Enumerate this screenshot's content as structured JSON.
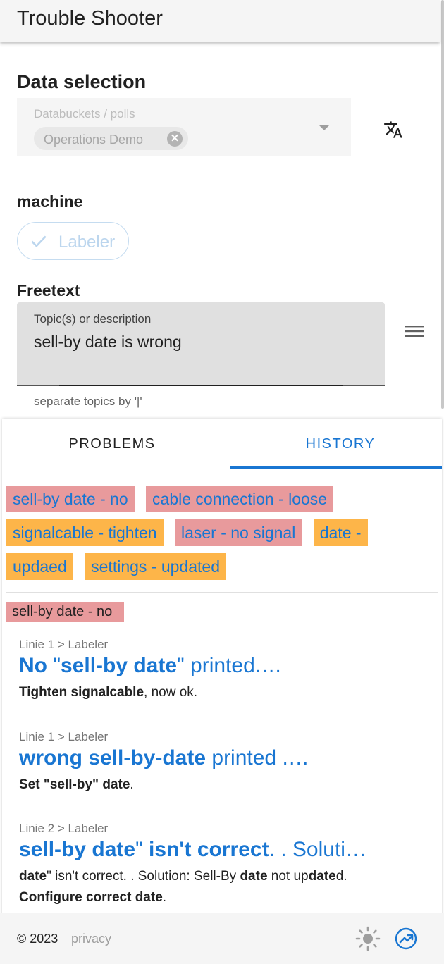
{
  "app": {
    "title": "Trouble Shooter"
  },
  "data_selection": {
    "heading": "Data selection",
    "field_label": "Databuckets / polls",
    "selected_chip": "Operations Demo",
    "translate_icon": "translate-icon"
  },
  "machine": {
    "heading": "machine",
    "selected": "Labeler"
  },
  "freetext": {
    "heading": "Freetext",
    "field_label": "Topic(s) or description",
    "value": "sell-by date is wrong",
    "hint": "separate topics by '|'"
  },
  "tabs": [
    {
      "label": "PROBLEMS",
      "active": false
    },
    {
      "label": "HISTORY",
      "active": true
    }
  ],
  "tags": [
    {
      "label": "sell-by date - no",
      "color": "#e89a9c"
    },
    {
      "label": "cable connection - loose",
      "color": "#e89a9c"
    },
    {
      "label": "signalcable - tighten",
      "color": "#fdb549"
    },
    {
      "label": "laser - no signal",
      "color": "#e89a9c"
    },
    {
      "label": "date - updaed",
      "color": "#fdb549"
    },
    {
      "label": "settings - updated",
      "color": "#fdb549"
    }
  ],
  "selected_tag": "sell-by date - no",
  "history": [
    {
      "path": "Linie 1 > Labeler",
      "head": [
        {
          "t": "No",
          "b": true
        },
        {
          "t": " \"",
          "b": false
        },
        {
          "t": "sell-by date",
          "b": true
        },
        {
          "t": "\" printed.…",
          "b": false
        }
      ],
      "desc": [
        [
          {
            "t": "Tighten signalcable",
            "b": true
          },
          {
            "t": ", now ok.",
            "b": false
          }
        ]
      ]
    },
    {
      "path": "Linie 1 > Labeler",
      "head": [
        {
          "t": "wrong sell-by-date",
          "b": true
        },
        {
          "t": " printed .…",
          "b": false
        }
      ],
      "desc": [
        [
          {
            "t": "Set \"sell-by\" date",
            "b": true
          },
          {
            "t": ".",
            "b": false
          }
        ]
      ]
    },
    {
      "path": "Linie 2 > Labeler",
      "head": [
        {
          "t": "sell-by date",
          "b": true
        },
        {
          "t": "\" ",
          "b": false
        },
        {
          "t": "isn't correct",
          "b": true
        },
        {
          "t": ". . Soluti…",
          "b": false
        }
      ],
      "desc": [
        [
          {
            "t": "date",
            "b": true
          },
          {
            "t": "\" isn't correct. . Solution: Sell-By ",
            "b": false
          },
          {
            "t": "date",
            "b": true
          },
          {
            "t": " not up",
            "b": false
          },
          {
            "t": "date",
            "b": true
          },
          {
            "t": "d.",
            "b": false
          }
        ],
        [
          {
            "t": "Configure correct date",
            "b": true
          },
          {
            "t": ".",
            "b": false
          }
        ]
      ]
    }
  ],
  "footer": {
    "copyright": "© 2023",
    "privacy": "privacy",
    "theme_icon": "sun-icon",
    "trend_icon": "trending-up-icon"
  },
  "colors": {
    "accent": "#1976d2",
    "tag_red": "#e89a9c",
    "tag_orange": "#fdb549"
  }
}
